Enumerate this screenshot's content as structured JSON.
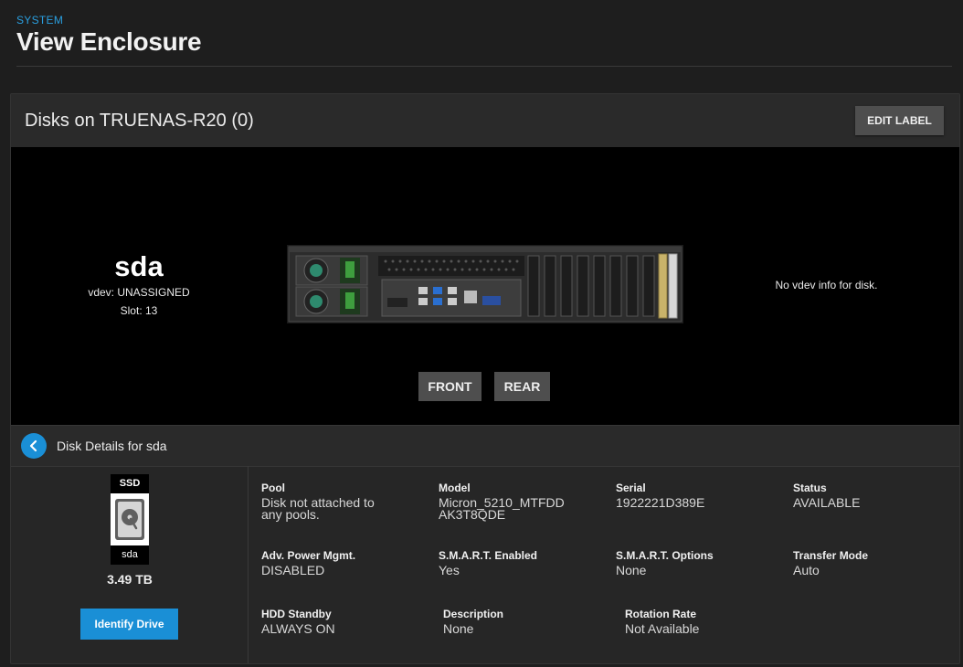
{
  "header": {
    "breadcrumb": "SYSTEM",
    "title": "View Enclosure"
  },
  "card": {
    "title": "Disks on TRUENAS-R20 (0)",
    "edit_label": "EDIT LABEL"
  },
  "selected_disk": {
    "name": "sda",
    "vdev": "vdev: UNASSIGNED",
    "slot": "Slot: 13"
  },
  "vdev_info": "No vdev info for disk.",
  "view_buttons": {
    "front": "FRONT",
    "rear": "REAR"
  },
  "details": {
    "title": "Disk Details for sda",
    "disk_type": "SSD",
    "disk_label": "sda",
    "size": "3.49 TB",
    "identify": "Identify Drive",
    "fields": [
      {
        "label": "Pool",
        "value": "Disk not attached to any pools."
      },
      {
        "label": "Model",
        "value": "Micron_5210_MTFDD AK3T8QDE"
      },
      {
        "label": "Serial",
        "value": "1922221D389E"
      },
      {
        "label": "Status",
        "value": "AVAILABLE"
      },
      {
        "label": "Adv. Power Mgmt.",
        "value": "DISABLED"
      },
      {
        "label": "S.M.A.R.T. Enabled",
        "value": "Yes"
      },
      {
        "label": "S.M.A.R.T. Options",
        "value": "None"
      },
      {
        "label": "Transfer Mode",
        "value": "Auto"
      },
      {
        "label": "HDD Standby",
        "value": "ALWAYS ON"
      },
      {
        "label": "Description",
        "value": "None"
      },
      {
        "label": "Rotation Rate",
        "value": "Not Available"
      }
    ]
  },
  "colors": {
    "accent": "#1a8fd6",
    "background": "#1e1e1e",
    "card": "#262626",
    "button": "#4e4e4e"
  }
}
